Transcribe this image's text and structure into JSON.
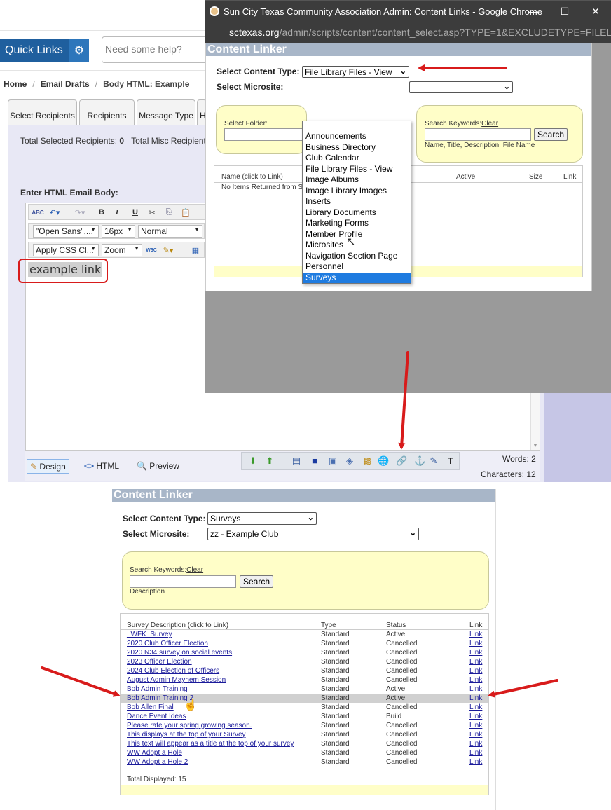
{
  "admin": {
    "quick_links": "Quick Links",
    "help_placeholder": "Need some help?",
    "breadcrumb": {
      "home": "Home",
      "email_drafts": "Email Drafts",
      "current": "Body HTML: Example"
    },
    "tabs": [
      "Select Recipients",
      "Recipients",
      "Message Type",
      "H"
    ],
    "totals": {
      "selected_label": "Total Selected Recipients:",
      "selected_value": "0",
      "misc_label": "Total Misc Recipient"
    },
    "enter_body_label": "Enter HTML Email Body:",
    "toolbar": {
      "font_family": "\"Open Sans\",...",
      "font_size": "16px",
      "format": "Normal",
      "css_class": "Apply CSS Cl...",
      "zoom": "Zoom"
    },
    "editor_text": "example link",
    "modes": {
      "design": "Design",
      "html": "HTML",
      "preview": "Preview"
    },
    "words": "Words: 2",
    "characters": "Characters: 12"
  },
  "chrome": {
    "title": "Sun City Texas Community Association Admin: Content Links - Google Chrome",
    "url_domain": "sctexas.org",
    "url_path": "/admin/scripts/content/content_select.asp?TYPE=1&EXCLUDETYPE=FILEL...",
    "controls": {
      "minimize": "—",
      "maximize": "☐",
      "close": "✕"
    }
  },
  "linker_popup": {
    "header": "Content Linker",
    "content_type_label": "Select Content Type:",
    "content_type_value": "File Library Files - View",
    "microsite_label": "Select Microsite:",
    "folder_label": "Select Folder:",
    "search_keywords_label": "Search Keywords:",
    "clear_link": "Clear",
    "search_button": "Search",
    "search_hint": "Name, Title, Description, File Name",
    "columns": [
      "Name (click to Link)",
      "Active",
      "Size",
      "Link"
    ],
    "empty_text": "No Items Returned from S",
    "dropdown_options": [
      "Announcements",
      "Business Directory",
      "Club Calendar",
      "File Library Files - View",
      "Image Albums",
      "Image Library Images",
      "Inserts",
      "Library Documents",
      "Marketing Forms",
      "Member Profile",
      "Microsites",
      "Navigation Section Page",
      "Personnel",
      "Surveys"
    ],
    "highlighted_option": "Surveys"
  },
  "linker_bottom": {
    "header": "Content Linker",
    "content_type_label": "Select Content Type:",
    "content_type_value": "Surveys",
    "microsite_label": "Select Microsite:",
    "microsite_value": "zz - Example Club",
    "search_keywords_label": "Search Keywords:",
    "clear_link": "Clear",
    "search_button": "Search",
    "search_hint": "Description",
    "columns": [
      "Survey Description (click to Link)",
      "Type",
      "Status",
      "Link"
    ],
    "rows": [
      {
        "name": "_WFK_Survey",
        "type": "Standard",
        "status": "Active",
        "link": "Link"
      },
      {
        "name": "2020 Club Officer Election",
        "type": "Standard",
        "status": "Cancelled",
        "link": "Link"
      },
      {
        "name": "2020 N34 survey on social events",
        "type": "Standard",
        "status": "Cancelled",
        "link": "Link"
      },
      {
        "name": "2023 Officer Election",
        "type": "Standard",
        "status": "Cancelled",
        "link": "Link"
      },
      {
        "name": "2024 Club Election of Officers",
        "type": "Standard",
        "status": "Cancelled",
        "link": "Link"
      },
      {
        "name": "August Admin Mayhem Session",
        "type": "Standard",
        "status": "Cancelled",
        "link": "Link"
      },
      {
        "name": "Bob Admin Training",
        "type": "Standard",
        "status": "Active",
        "link": "Link"
      },
      {
        "name": "Bob Admin Training 2",
        "type": "Standard",
        "status": "Active",
        "link": "Link"
      },
      {
        "name": "Bob Allen Final",
        "type": "Standard",
        "status": "Cancelled",
        "link": "Link"
      },
      {
        "name": "Dance Event Ideas",
        "type": "Standard",
        "status": "Build",
        "link": "Link"
      },
      {
        "name": "Please rate your spring growing season.",
        "type": "Standard",
        "status": "Cancelled",
        "link": "Link"
      },
      {
        "name": "This displays at the top of your Survey",
        "type": "Standard",
        "status": "Cancelled",
        "link": "Link"
      },
      {
        "name": "This text will appear as a title at the top of your survey",
        "type": "Standard",
        "status": "Cancelled",
        "link": "Link"
      },
      {
        "name": "WW Adopt a Hole",
        "type": "Standard",
        "status": "Cancelled",
        "link": "Link"
      },
      {
        "name": "WW Adopt a Hole 2",
        "type": "Standard",
        "status": "Cancelled",
        "link": "Link"
      }
    ],
    "highlighted_row": "Bob Admin Training 2",
    "total_displayed": "Total Displayed: 15"
  },
  "annotation_color": "#d81b1b"
}
